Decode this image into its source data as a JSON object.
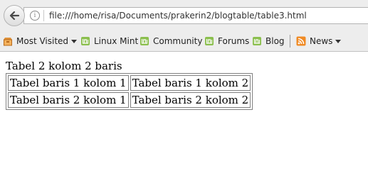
{
  "browser": {
    "url": "file:///home/risa/Documents/prakerin2/blogtable/table3.html"
  },
  "bookmarks": [
    {
      "label": "Most Visited",
      "icon": "most-visited-icon",
      "dropdown": true
    },
    {
      "label": "Linux Mint",
      "icon": "mint-leaf-icon",
      "dropdown": false
    },
    {
      "label": "Community",
      "icon": "mint-leaf-icon",
      "dropdown": false
    },
    {
      "label": "Forums",
      "icon": "mint-leaf-icon",
      "dropdown": false
    },
    {
      "label": "Blog",
      "icon": "mint-leaf-icon",
      "dropdown": false
    },
    {
      "label": "News",
      "icon": "rss-feed-icon",
      "dropdown": true
    }
  ],
  "page": {
    "caption": "Tabel 2 kolom 2 baris",
    "rows": [
      [
        "Tabel baris 1 kolom 1",
        "Tabel baris 1 kolom 2"
      ],
      [
        "Tabel baris 2 kolom 1",
        "Tabel baris 2 kolom 2"
      ]
    ]
  },
  "colors": {
    "mint_green": "#8bbf4e",
    "rss_orange": "#f08a24",
    "toolbar_bg": "#ededed"
  }
}
